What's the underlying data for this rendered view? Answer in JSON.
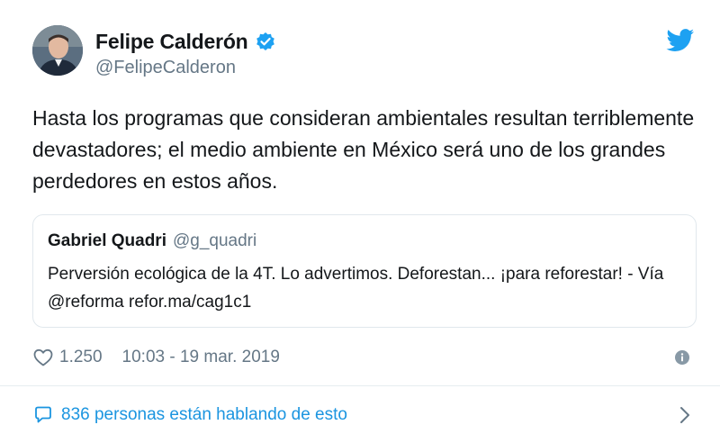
{
  "author": {
    "display_name": "Felipe Calderón",
    "handle": "@FelipeCalderon",
    "verified_icon": "verified-badge-icon",
    "avatar": "avatar"
  },
  "tweet": {
    "text": "Hasta los programas que consideran ambientales resultan terriblemente devastadores; el medio ambiente en México será uno de los grandes perdedores en estos años."
  },
  "quote": {
    "name": "Gabriel Quadri",
    "handle": "@g_quadri",
    "text": "Perversión ecológica de la 4T. Lo advertimos. Deforestan... ¡para reforestar! - Vía @reforma refor.ma/cag1c1"
  },
  "meta": {
    "likes": "1.250",
    "timestamp": "10:03 - 19 mar. 2019"
  },
  "footer": {
    "conversation": "836 personas están hablando de esto"
  },
  "colors": {
    "brand_blue": "#1da1f2",
    "link_blue": "#1b95e0",
    "secondary_text": "#657786",
    "border": "#e1e8ed"
  }
}
